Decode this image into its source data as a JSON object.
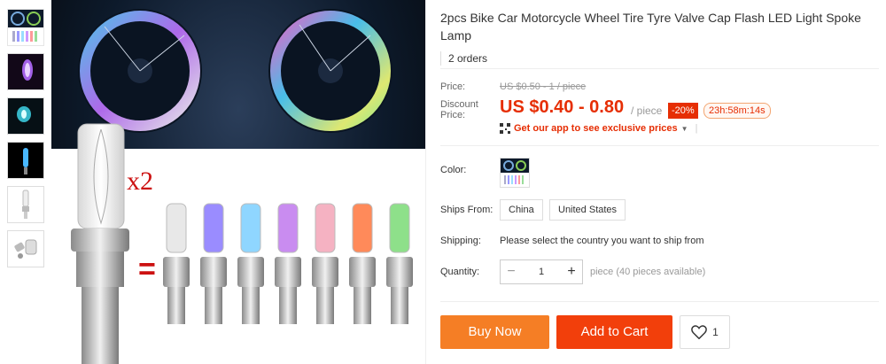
{
  "product": {
    "title": "2pcs Bike Car Motorcycle Wheel Tire Tyre Valve Cap Flash LED Light Spoke Lamp",
    "orders": "2 orders"
  },
  "gallery": {
    "overlay_multiplier": "x2",
    "overlay_equals": "="
  },
  "price": {
    "price_label": "Price:",
    "original": "US $0.50 - 1 / piece",
    "discount_label": "Discount Price:",
    "current": "US $0.40 - 0.80",
    "per_unit": "/ piece",
    "discount_badge": "-20%",
    "countdown": "23h:58m:14s",
    "app_promo": "Get our app to see exclusive prices",
    "app_promo_sep": "|"
  },
  "properties": {
    "color_label": "Color:",
    "ships_from_label": "Ships From:",
    "ships_from_options": [
      "China",
      "United States"
    ],
    "shipping_label": "Shipping:",
    "shipping_text": "Please select the country you want to ship from",
    "quantity_label": "Quantity:",
    "quantity_minus": "−",
    "quantity_plus": "+",
    "quantity_value": "1",
    "quantity_hint": "piece (40 pieces available)"
  },
  "actions": {
    "buy_now": "Buy Now",
    "add_to_cart": "Add to Cart",
    "wishlist_count": "1"
  },
  "colors": {
    "accent": "#e62e04",
    "buy_now": "#f57e25",
    "add_to_cart": "#f23f0b"
  }
}
